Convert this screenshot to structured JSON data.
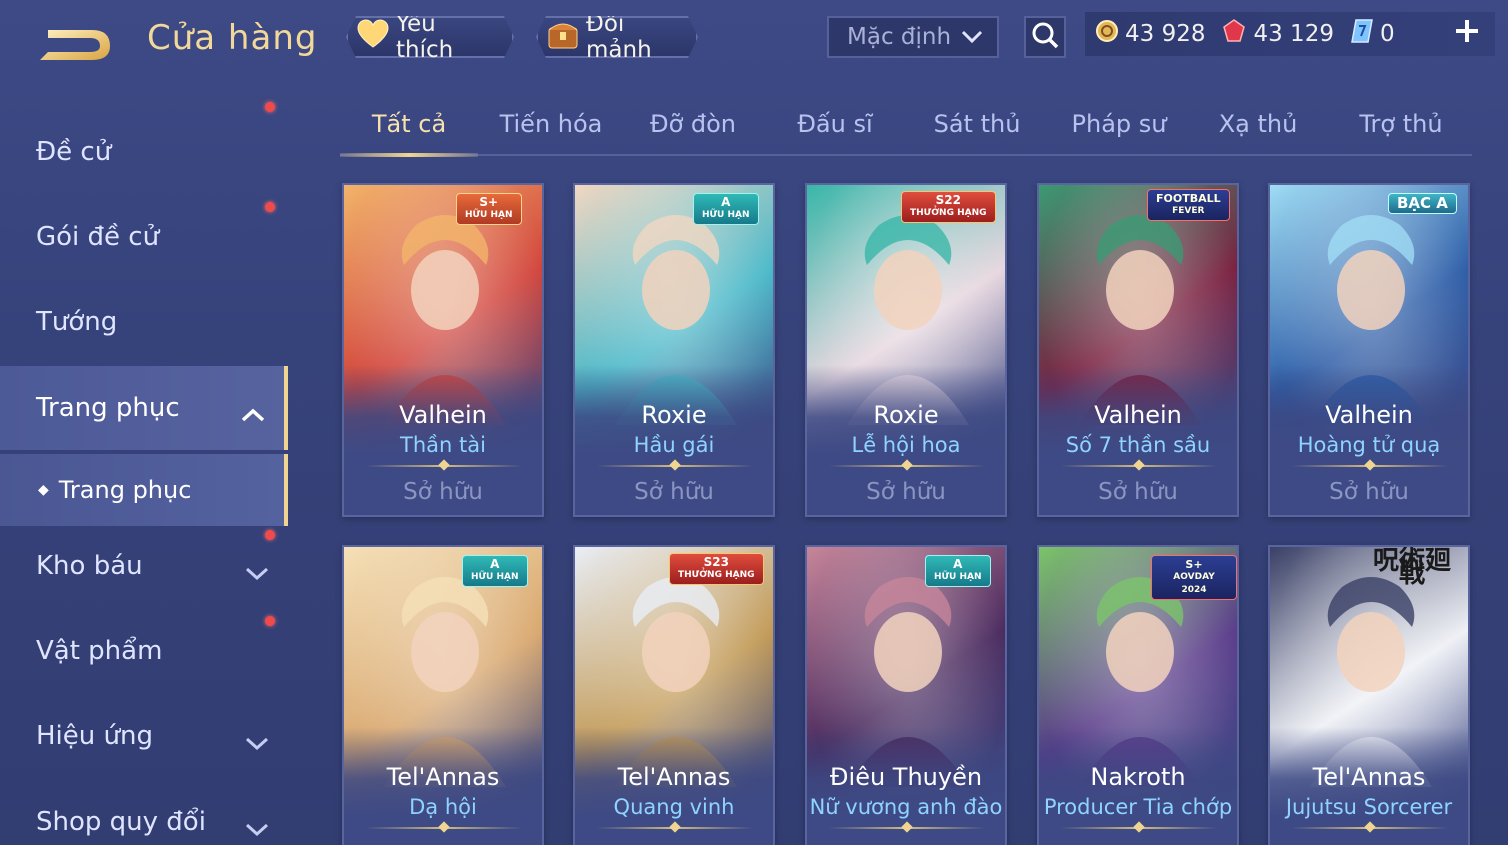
{
  "header": {
    "title": "Cửa hàng",
    "favorite_label": "Yêu thích",
    "shard_label": "Đổi mảnh",
    "sort_value": "Mặc định",
    "currency": {
      "gold": "43 928",
      "gems": "43 129",
      "vouchers": "0"
    }
  },
  "sidebar": {
    "items": [
      {
        "label": "Đề cử"
      },
      {
        "label": "Gói đề cử"
      },
      {
        "label": "Tướng"
      },
      {
        "label": "Trang phục"
      },
      {
        "label": "Trang phục"
      },
      {
        "label": "Kho báu"
      },
      {
        "label": "Vật phẩm"
      },
      {
        "label": "Hiệu ứng"
      },
      {
        "label": "Shop quy đổi"
      }
    ]
  },
  "tabs": [
    {
      "label": "Tất cả"
    },
    {
      "label": "Tiến hóa"
    },
    {
      "label": "Đỡ đòn"
    },
    {
      "label": "Đấu sĩ"
    },
    {
      "label": "Sát thủ"
    },
    {
      "label": "Pháp sư"
    },
    {
      "label": "Xạ thủ"
    },
    {
      "label": "Trợ thủ"
    }
  ],
  "cards": [
    {
      "hero": "Valhein",
      "skin": "Thần tài",
      "status": "Sở hữu",
      "badge": "S+",
      "badge_sub": "HỮU HẠN",
      "colors": [
        "#d2453c",
        "#f2b46a"
      ]
    },
    {
      "hero": "Roxie",
      "skin": "Hầu gái",
      "status": "Sở hữu",
      "badge": "A",
      "badge_sub": "HỮU HẠN",
      "colors": [
        "#4bb9c9",
        "#f1d7c2"
      ]
    },
    {
      "hero": "Roxie",
      "skin": "Lễ hội hoa",
      "status": "Sở hữu",
      "badge": "S22",
      "badge_sub": "THƯỞNG HẠNG",
      "colors": [
        "#e7d7df",
        "#39b6a9"
      ]
    },
    {
      "hero": "Valhein",
      "skin": "Số 7 thần sầu",
      "status": "Sở hữu",
      "badge": "FOOTBALL",
      "badge_sub": "FEVER",
      "colors": [
        "#7a2140",
        "#3b9a74"
      ]
    },
    {
      "hero": "Valhein",
      "skin": "Hoàng tử quạ",
      "status": "Sở hữu",
      "badge": "BẠC A",
      "badge_sub": "",
      "colors": [
        "#2e5ea8",
        "#9fdcf4"
      ]
    },
    {
      "hero": "Tel'Annas",
      "skin": "Dạ hội",
      "status": "",
      "badge": "A",
      "badge_sub": "HỮU HẠN",
      "colors": [
        "#d9a86f",
        "#f5e0b8"
      ]
    },
    {
      "hero": "Tel'Annas",
      "skin": "Quang vinh",
      "status": "",
      "badge": "S23",
      "badge_sub": "THƯỞNG HẠNG",
      "colors": [
        "#c29a56",
        "#e9eef6"
      ]
    },
    {
      "hero": "Điêu Thuyền",
      "skin": "Nữ vương anh đào",
      "status": "",
      "badge": "A",
      "badge_sub": "HỮU HẠN",
      "colors": [
        "#4a2a5e",
        "#c7869a"
      ]
    },
    {
      "hero": "Nakroth",
      "skin": "Producer Tia chớp",
      "status": "",
      "badge": "S+",
      "badge_sub": "AOVDAY 2024",
      "colors": [
        "#5a3c8a",
        "#7bc46a"
      ]
    },
    {
      "hero": "Tel'Annas",
      "skin": "Jujutsu Sorcerer",
      "status": "",
      "badge": "呪術廻戦",
      "badge_sub": "",
      "colors": [
        "#eef0f5",
        "#3a4066"
      ]
    }
  ],
  "colors": {
    "accent_gold": "#f0d592",
    "skin_name_blue": "#8fd3ff",
    "notification_red": "#f04a4a"
  }
}
